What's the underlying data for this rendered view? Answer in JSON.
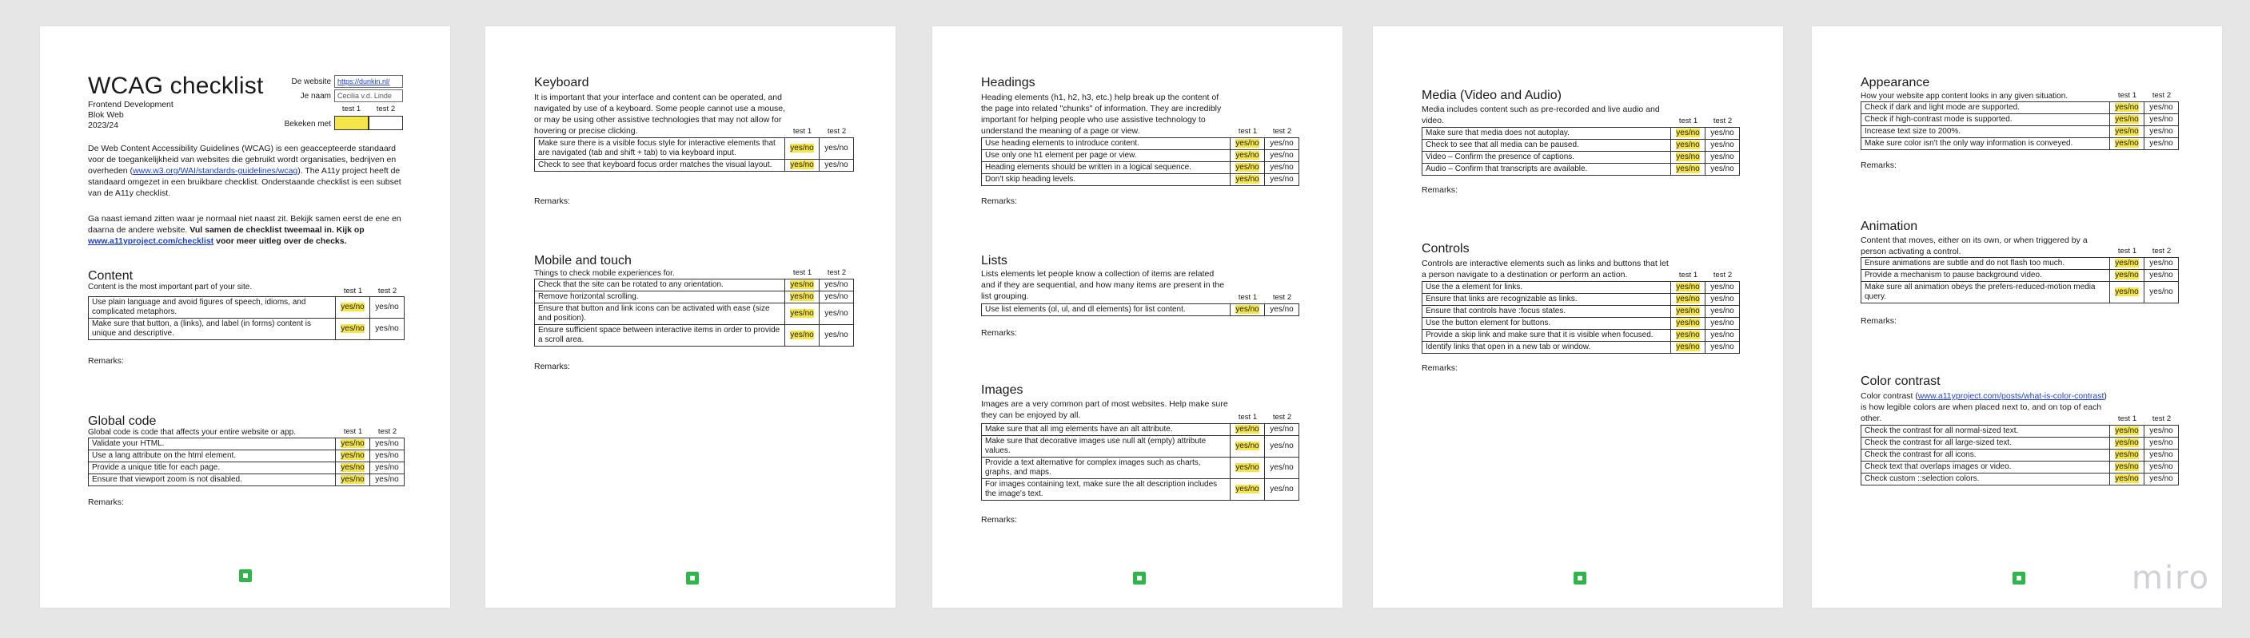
{
  "p1": {
    "title": "WCAG checklist",
    "subtitle": [
      "Frontend Development",
      "Blok Web",
      "2023/24"
    ],
    "website_label": "De website",
    "website_value": "https://dunkin.nl/",
    "name_label": "Je naam",
    "name_value": "Cecilia v.d. Linde",
    "viewed_label": "Bekeken met",
    "intro1_a": "De Web Content Accessibility Guidelines (WCAG) is een geaccepteerde standaard voor de toegankelijkheid van websites die gebruikt wordt organisaties, bedrijven en overheden (",
    "intro1_link": "www.w3.org/WAI/standards-guidelines/wcag",
    "intro1_b": "). The A11y project heeft de standaard omgezet in een bruikbare checklist. Onderstaande checklist is een subset van de A11y checklist.",
    "intro2_a": "Ga naast iemand zitten waar je normaal niet naast zit. Bekijk samen eerst de ene en daarna de andere website. ",
    "intro2_b": "Vul samen de checklist tweemaal in. Kijk op ",
    "intro2_link": "www.a11yproject.com/checklist",
    "intro2_c": " voor meer uitleg over de checks.",
    "content_title": "Content",
    "content_desc": "Content is the most important part of your site.",
    "content_items": [
      "Use plain language and avoid figures of speech, idioms, and complicated metaphors.",
      "Make sure that button, a (links), and label (in forms) content is unique and descriptive."
    ],
    "global_title": "Global code",
    "global_desc": "Global code is code that affects your entire website or app.",
    "global_items": [
      "Validate your HTML.",
      "Use a lang attribute on the html element.",
      "Provide a unique title for each page.",
      "Ensure that viewport zoom is not disabled."
    ]
  },
  "p2": {
    "keyboard_title": "Keyboard",
    "keyboard_desc": "It is important that your interface and content can be operated, and navigated by use of a keyboard. Some people cannot use a mouse, or may be using other assistive technologies that may not allow for hovering or precise clicking.",
    "keyboard_items": [
      "Make sure there is a visible focus style for interactive elements that are navigated (tab and shift + tab) to via keyboard input.",
      "Check to see that keyboard focus order matches the visual layout."
    ],
    "mobile_title": "Mobile and touch",
    "mobile_desc": "Things to check mobile experiences for.",
    "mobile_items": [
      "Check that the site can be rotated to any orientation.",
      "Remove horizontal scrolling.",
      "Ensure that button and link icons can be activated with ease (size and position).",
      "Ensure sufficient space between interactive items in order to provide a scroll area."
    ]
  },
  "p3": {
    "headings_title": "Headings",
    "headings_desc": "Heading elements (h1, h2, h3, etc.) help break up the content of the page into related \"chunks\" of information. They are incredibly important for helping people who use assistive technology to understand the meaning of a page or view.",
    "headings_items": [
      "Use heading elements to introduce content.",
      "Use only one h1 element per page or view.",
      "Heading elements should be written in a logical sequence.",
      "Don't skip heading levels."
    ],
    "lists_title": "Lists",
    "lists_desc": "Lists elements let people know a collection of items are related and if they are sequential, and how many items are present in the list grouping.",
    "lists_items": [
      "Use list elements (ol, ul, and dl elements) for list content."
    ],
    "images_title": "Images",
    "images_desc": "Images are a very common part of most websites. Help make sure they can be enjoyed by all.",
    "images_items": [
      "Make sure that all img elements have an alt attribute.",
      "Make sure that decorative images use null alt (empty) attribute values.",
      "Provide a text alternative for complex images such as charts, graphs, and maps.",
      "For images containing text, make sure the alt description includes the image's text."
    ]
  },
  "p4": {
    "media_title": "Media (Video and Audio)",
    "media_desc": "Media includes content such as pre-recorded and live audio and video.",
    "media_items": [
      "Make sure that media does not autoplay.",
      "Check to see that all media can be paused.",
      "Video – Confirm the presence of captions.",
      "Audio – Confirm that transcripts are available."
    ],
    "controls_title": "Controls",
    "controls_desc": "Controls are interactive elements such as links and buttons that let a person navigate to a destination or perform an action.",
    "controls_items": [
      "Use the a element for links.",
      "Ensure that links are recognizable as links.",
      "Ensure that controls have :focus states.",
      "Use the button element for buttons.",
      "Provide a skip link and make sure that it is visible when focused.",
      "Identify links that open in a new tab or window."
    ]
  },
  "p5": {
    "appearance_title": "Appearance",
    "appearance_desc": "How your website app content looks in any given situation.",
    "appearance_items": [
      "Check if dark and light mode are supported.",
      "Check if high-contrast mode is supported.",
      "Increase text size to 200%.",
      "Make sure color isn't the only way information is conveyed."
    ],
    "animation_title": "Animation",
    "animation_desc": "Content that moves, either on its own, or when triggered by a person activating a control.",
    "animation_items": [
      "Ensure animations are subtle and do not flash too much.",
      "Provide a mechanism to pause background video.",
      "Make sure all animation obeys the prefers-reduced-motion media query."
    ],
    "color_title": "Color contrast",
    "color_desc_a": "Color contrast (",
    "color_link": "www.a11yproject.com/posts/what-is-color-contrast",
    "color_desc_b": ") is how legible colors are when placed next to, and on top of each other.",
    "color_items": [
      "Check the contrast for all normal-sized text.",
      "Check the contrast for all large-sized text.",
      "Check the contrast for all icons.",
      "Check text that overlaps images or video.",
      "Check custom ::selection colors."
    ],
    "brand": "miro"
  },
  "common": {
    "test1": "test 1",
    "test2": "test 2",
    "yes": "yes",
    "slash_no": "/no",
    "yesno": "yes/no",
    "remarks": "Remarks:"
  },
  "colors": {
    "highlight": "#f5e54a",
    "logo": "#2fb64a",
    "link": "#1a3fd9"
  }
}
